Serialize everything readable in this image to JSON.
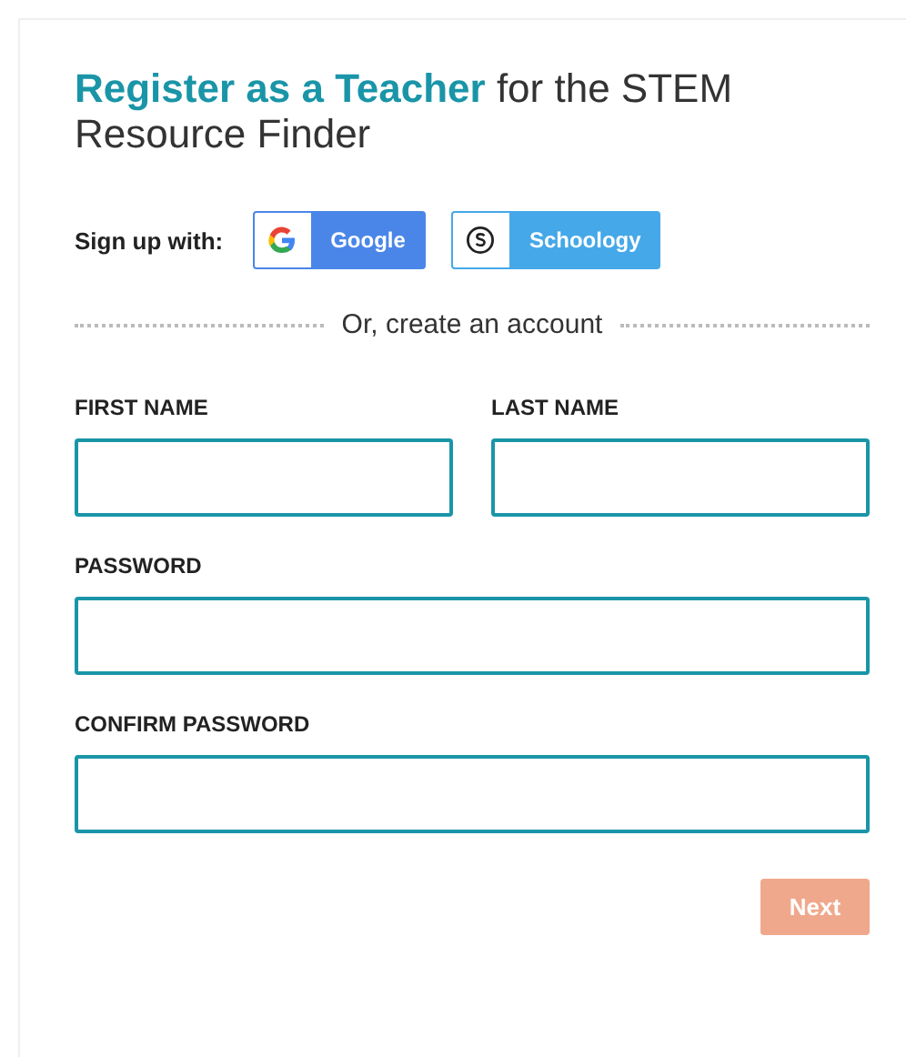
{
  "heading": "**Register as a Teacher** for the STEM Resource Finder",
  "signup": {
    "label": "Sign up with:",
    "providers": [
      {
        "kind": "google",
        "label": "Google"
      },
      {
        "kind": "schoology",
        "label": "Schoology"
      }
    ]
  },
  "divider": "Or, create an account",
  "field_rows": [
    [
      {
        "label": "FIRST NAME"
      },
      {
        "label": "LAST NAME"
      }
    ],
    [
      {
        "label": "PASSWORD"
      }
    ],
    [
      {
        "label": "CONFIRM PASSWORD"
      }
    ]
  ],
  "next": {
    "label": "Next",
    "disabled": true
  }
}
